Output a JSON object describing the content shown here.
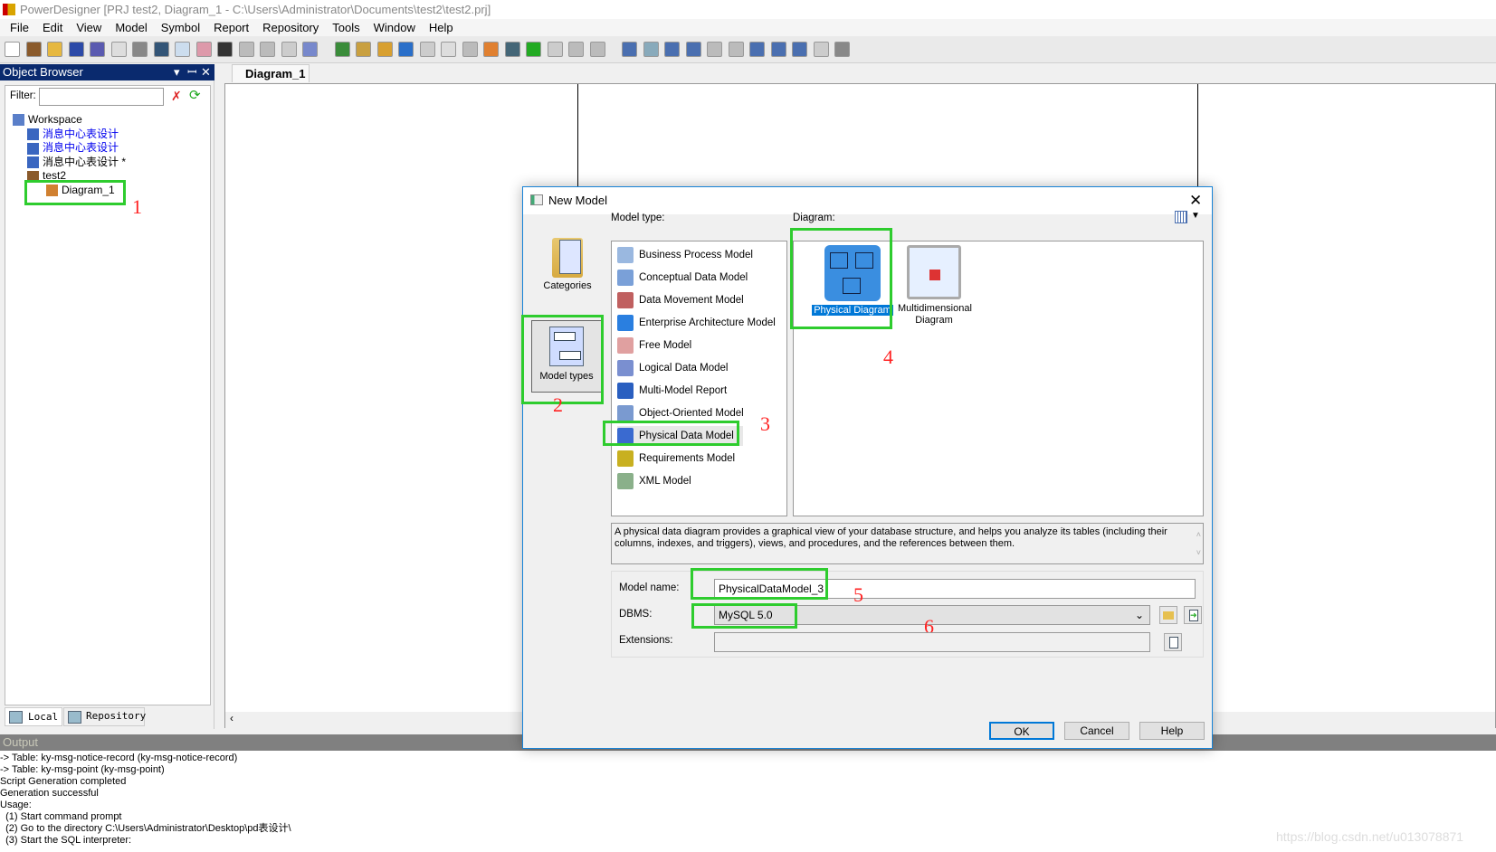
{
  "window": {
    "title": "PowerDesigner [PRJ test2, Diagram_1 - C:\\Users\\Administrator\\Documents\\test2\\test2.prj]"
  },
  "menu": [
    "File",
    "Edit",
    "View",
    "Model",
    "Symbol",
    "Report",
    "Repository",
    "Tools",
    "Window",
    "Help"
  ],
  "object_browser": {
    "title": "Object Browser",
    "filter_label": "Filter:",
    "filter_value": "",
    "tree": [
      {
        "label": "Workspace",
        "color": "#000"
      },
      {
        "label": "消息中心表设计",
        "color": "#0000ee"
      },
      {
        "label": "消息中心表设计",
        "color": "#0000ee"
      },
      {
        "label": "消息中心表设计 *",
        "color": "#000"
      },
      {
        "label": "test2",
        "color": "#000"
      },
      {
        "label": "Diagram_1",
        "color": "#000"
      }
    ],
    "tabs": [
      "Local",
      "Repository"
    ]
  },
  "editor": {
    "tab": "Diagram_1"
  },
  "annotations": [
    "1",
    "2",
    "3",
    "4",
    "5",
    "6"
  ],
  "output": {
    "title": "Output",
    "lines": [
      "-> Table: ky-msg-notice-record (ky-msg-notice-record)",
      "-> Table: ky-msg-point (ky-msg-point)",
      "Script Generation completed",
      "Generation successful",
      "",
      "Usage:",
      "  (1) Start command prompt",
      "  (2) Go to the directory C:\\Users\\Administrator\\Desktop\\pd表设计\\",
      "  (3) Start the SQL interpreter:"
    ]
  },
  "dialog": {
    "title": "New Model",
    "categories_label": "Categories",
    "model_types_label": "Model types",
    "model_type_label": "Model type:",
    "diagram_label": "Diagram:",
    "model_types": [
      "Business Process Model",
      "Conceptual Data Model",
      "Data Movement Model",
      "Enterprise Architecture Model",
      "Free Model",
      "Logical Data Model",
      "Multi-Model Report",
      "Object-Oriented Model",
      "Physical Data Model",
      "Requirements Model",
      "XML Model"
    ],
    "selected_model_type": "Physical Data Model",
    "diagrams": [
      "Physical Diagram",
      "Multidimensional Diagram"
    ],
    "selected_diagram": "Physical Diagram",
    "description": "A physical data diagram provides a graphical view of your database structure, and helps you analyze its tables (including their columns, indexes, and triggers), views, and procedures, and the references between them.",
    "model_name_label": "Model name:",
    "model_name": "PhysicalDataModel_3",
    "dbms_label": "DBMS:",
    "dbms": "MySQL 5.0",
    "extensions_label": "Extensions:",
    "extensions": "",
    "ok": "OK",
    "cancel": "Cancel",
    "help": "Help"
  },
  "watermark": "https://blog.csdn.net/u013078871",
  "colors": {
    "highlight": "#2ecc2e",
    "annotation": "#ff2222",
    "selection": "#0078d7"
  }
}
